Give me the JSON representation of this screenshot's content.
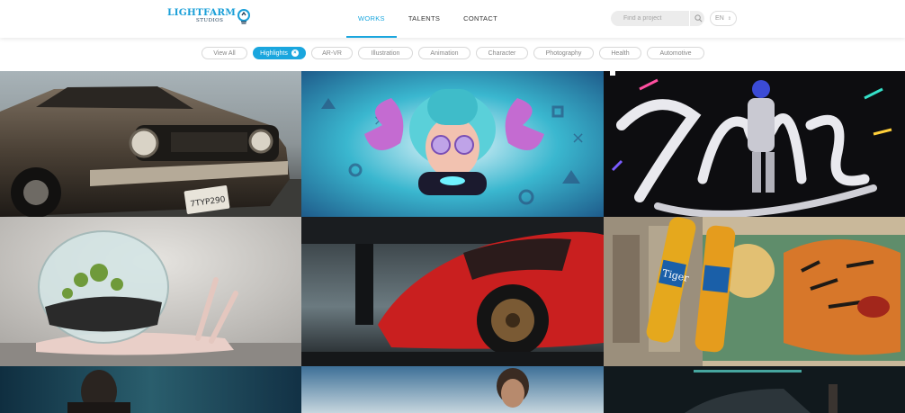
{
  "brand": {
    "name": "LIGHTFARM",
    "sub": "STUDIOS",
    "accent": "#1aa6de"
  },
  "nav": {
    "items": [
      {
        "label": "WORKS",
        "active": true
      },
      {
        "label": "TALENTS",
        "active": false
      },
      {
        "label": "CONTACT",
        "active": false
      }
    ]
  },
  "search": {
    "placeholder": "Find a project",
    "icon": "search-icon"
  },
  "language": {
    "value": "EN",
    "arrow": "chevron-down-icon"
  },
  "filters": [
    {
      "label": "View All",
      "active": false
    },
    {
      "label": "Highlights",
      "active": true
    },
    {
      "label": "AR-VR",
      "active": false
    },
    {
      "label": "Illustration",
      "active": false
    },
    {
      "label": "Animation",
      "active": false
    },
    {
      "label": "Character",
      "active": false
    },
    {
      "label": "Photography",
      "active": false
    },
    {
      "label": "Health",
      "active": false
    },
    {
      "label": "Automotive",
      "active": false
    }
  ],
  "projects": [
    {
      "subject": "classic-muscle-car",
      "plate": "7TYP290"
    },
    {
      "subject": "gamer-girl-octopus-hair"
    },
    {
      "subject": "smoze-graffiti-dancer",
      "text": "SMOZE"
    },
    {
      "subject": "terrarium-snail"
    },
    {
      "subject": "red-sports-car"
    },
    {
      "subject": "tiger-beer-mural",
      "text": "Tiger"
    },
    {
      "subject": "man-portrait-teal"
    },
    {
      "subject": "man-portrait-sky"
    },
    {
      "subject": "car-garage-night"
    }
  ]
}
